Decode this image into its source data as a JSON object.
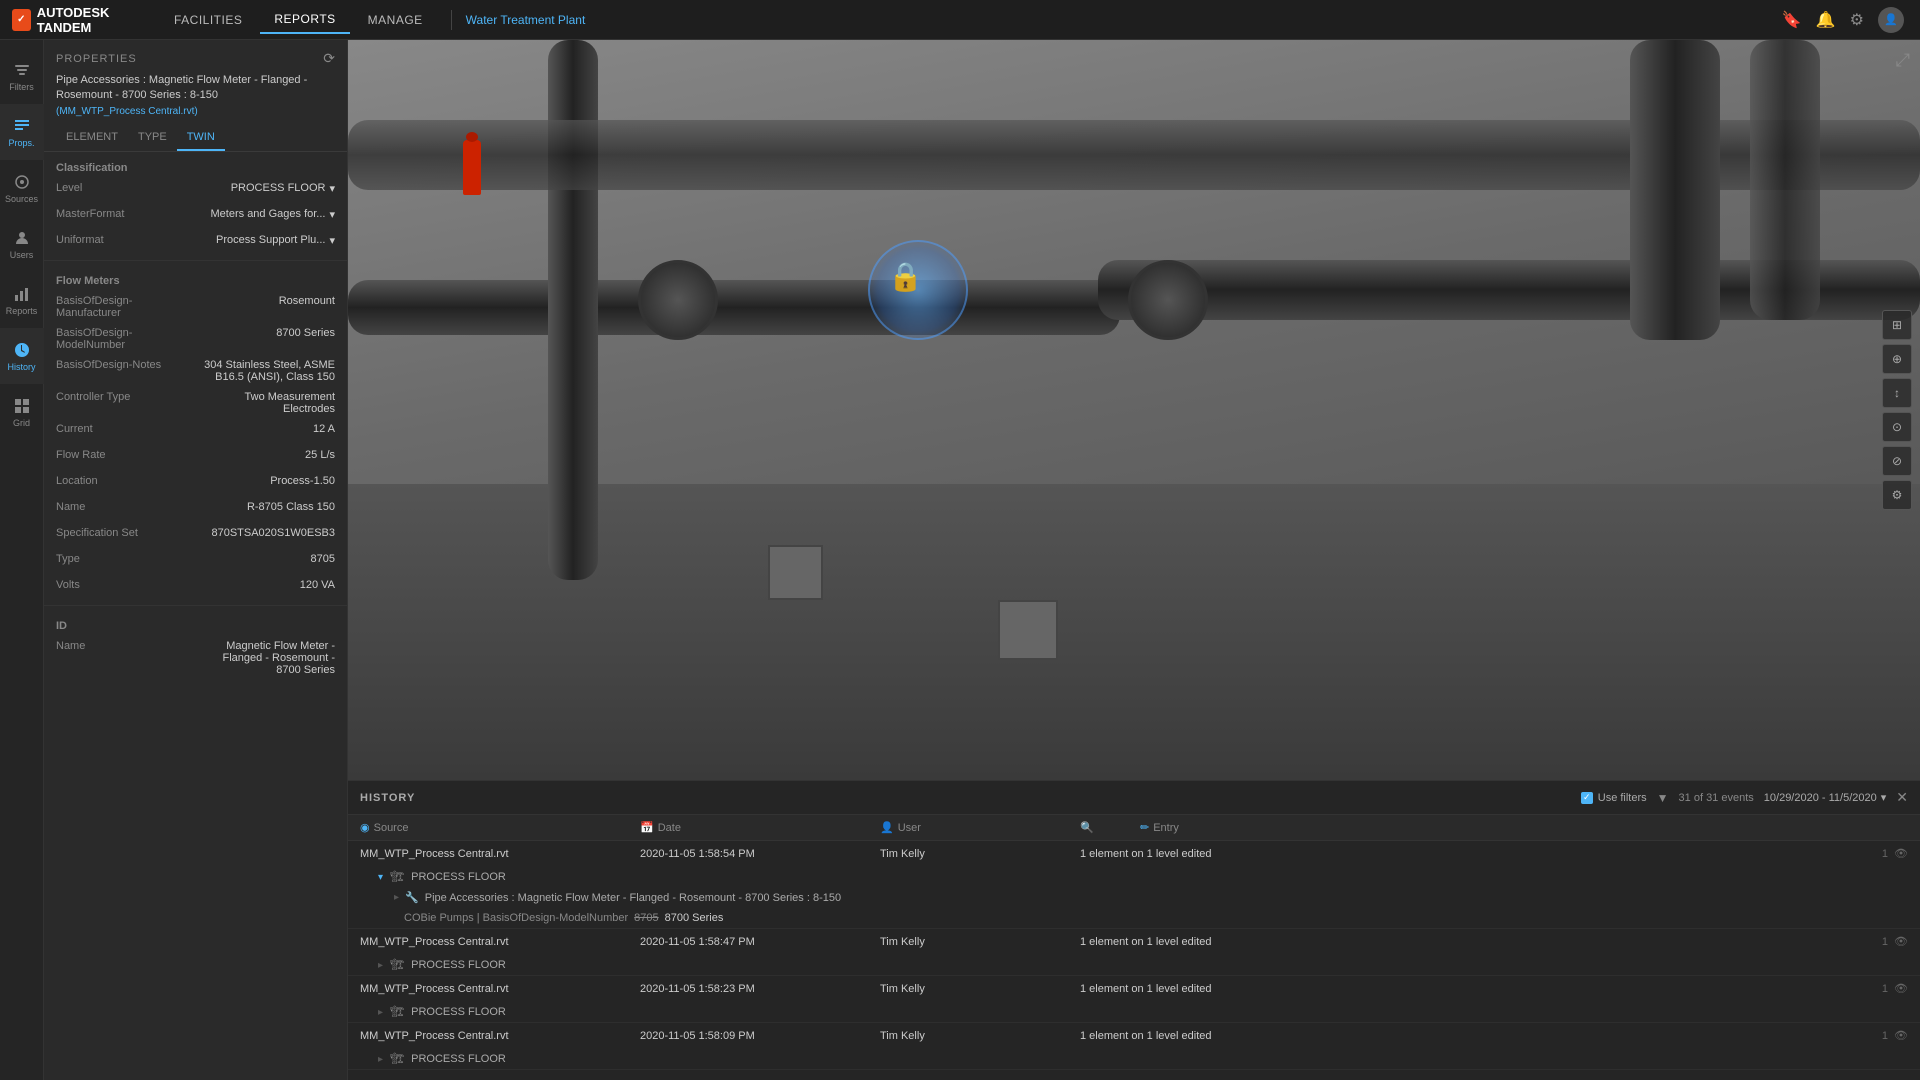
{
  "app": {
    "logo_text": "AUTODESK TANDEM",
    "logo_short": "A",
    "nav_links": [
      "FACILITIES",
      "REPORTS",
      "MANAGE"
    ],
    "active_nav": "REPORTS",
    "facility_name": "Water Treatment Plant"
  },
  "sidebar": {
    "items": [
      {
        "id": "filters",
        "label": "Filters",
        "icon": "filter"
      },
      {
        "id": "props",
        "label": "Props.",
        "icon": "list"
      },
      {
        "id": "sources",
        "label": "Sources",
        "icon": "source"
      },
      {
        "id": "users",
        "label": "Users",
        "icon": "user"
      },
      {
        "id": "reports",
        "label": "Reports",
        "icon": "bar-chart"
      },
      {
        "id": "history",
        "label": "History",
        "icon": "clock"
      },
      {
        "id": "grid",
        "label": "Grid",
        "icon": "grid"
      }
    ],
    "active": "history"
  },
  "properties": {
    "title": "PROPERTIES",
    "subtitle": "Pipe Accessories : Magnetic Flow Meter - Flanged - Rosemount - 8700 Series : 8-150",
    "file": "(MM_WTP_Process Central.rvt)",
    "tabs": [
      "ELEMENT",
      "TYPE",
      "TWIN"
    ],
    "active_tab": "TWIN",
    "sections": {
      "classification": {
        "title": "Classification",
        "fields": [
          {
            "label": "Level",
            "value": "PROCESS FLOOR",
            "dropdown": true
          },
          {
            "label": "MasterFormat",
            "value": "Meters and Gages for...",
            "dropdown": true
          },
          {
            "label": "Uniformat",
            "value": "Process Support Plu...",
            "dropdown": true
          }
        ]
      },
      "flow_meters": {
        "title": "Flow Meters",
        "fields": [
          {
            "label": "BasisOfDesign-Manufacturer",
            "value": "Rosemount"
          },
          {
            "label": "BasisOfDesign-ModelNumber",
            "value": "8700 Series"
          },
          {
            "label": "BasisOfDesign-Notes",
            "value": "304 Stainless Steel, ASME B16.5 (ANSI), Class 150"
          },
          {
            "label": "Controller Type",
            "value": "Two Measurement Electrodes"
          },
          {
            "label": "Current",
            "value": "12 A"
          },
          {
            "label": "Flow Rate",
            "value": "25 L/s"
          },
          {
            "label": "Location",
            "value": "Process-1.50"
          },
          {
            "label": "Name",
            "value": "R-8705 Class 150"
          },
          {
            "label": "Specification Set",
            "value": "870STSA020S1W0ESB3"
          },
          {
            "label": "Type",
            "value": "8705"
          },
          {
            "label": "Volts",
            "value": "120 VA"
          }
        ]
      },
      "id": {
        "title": "ID",
        "fields": [
          {
            "label": "Name",
            "value": "Magnetic Flow Meter - Flanged - Rosemount - 8700 Series"
          }
        ]
      }
    }
  },
  "history": {
    "title": "HISTORY",
    "use_filters": "Use filters",
    "filter_checked": true,
    "events_count": "31 of 31 events",
    "date_range": "10/29/2020 - 11/5/2020",
    "columns": {
      "source": "Source",
      "date": "Date",
      "user": "User",
      "entry": "Entry",
      "search_icon": "🔍"
    },
    "rows": [
      {
        "source": "MM_WTP_Process Central.rvt",
        "date": "2020-11-05 1:58:54 PM",
        "user": "Tim Kelly",
        "entry": "1 element on 1 level edited",
        "count": "1",
        "expanded": true,
        "detail_level": "PROCESS FLOOR",
        "detail_element": "Pipe Accessories : Magnetic Flow Meter - Flanged - Rosemount - 8700 Series : 8-150",
        "detail_cobie": "COBie Pumps | BasisOfDesign-ModelNumber",
        "detail_value_old": "8705",
        "detail_value_new": "8700 Series"
      },
      {
        "source": "MM_WTP_Process Central.rvt",
        "date": "2020-11-05 1:58:47 PM",
        "user": "Tim Kelly",
        "entry": "1 element on 1 level edited",
        "count": "1",
        "expanded": false,
        "detail_level": "PROCESS FLOOR"
      },
      {
        "source": "MM_WTP_Process Central.rvt",
        "date": "2020-11-05 1:58:23 PM",
        "user": "Tim Kelly",
        "entry": "1 element on 1 level edited",
        "count": "1",
        "expanded": false,
        "detail_level": "PROCESS FLOOR"
      },
      {
        "source": "MM_WTP_Process Central.rvt",
        "date": "2020-11-05 1:58:09 PM",
        "user": "Tim Kelly",
        "entry": "1 element on 1 level edited",
        "count": "1",
        "expanded": false,
        "detail_level": "PROCESS FLOOR"
      }
    ]
  },
  "viewport_buttons": [
    "⊞",
    "⊕",
    "↕",
    "⊙",
    "⊘",
    "⚙"
  ],
  "icons": {
    "filter": "▦",
    "list": "≡",
    "source": "◎",
    "user": "👤",
    "bar_chart": "📊",
    "clock": "🕐",
    "grid": "⊞",
    "close": "✕",
    "chevron_down": "▾",
    "chevron_right": "▸",
    "chevron_down_blue": "▾",
    "building": "🏢",
    "element": "🔧",
    "search": "🔍",
    "eye": "👁",
    "history_icon": "⟳",
    "bookmark": "🔖",
    "bell": "🔔",
    "gear": "⚙",
    "check": "✓"
  }
}
